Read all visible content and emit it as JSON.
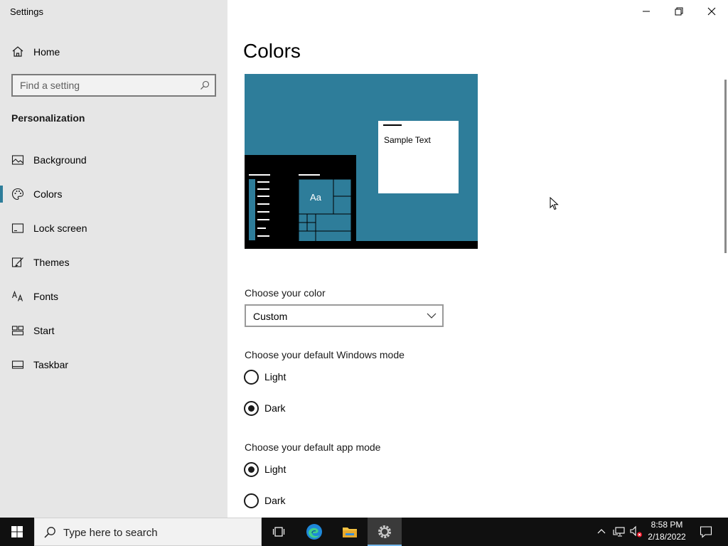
{
  "window": {
    "title": "Settings",
    "controls": [
      "minimize",
      "restore",
      "close"
    ]
  },
  "sidebar": {
    "home_label": "Home",
    "search_placeholder": "Find a setting",
    "section_title": "Personalization",
    "items": [
      {
        "label": "Background",
        "icon": "picture-icon",
        "active": false
      },
      {
        "label": "Colors",
        "icon": "palette-icon",
        "active": true
      },
      {
        "label": "Lock screen",
        "icon": "lock-screen-icon",
        "active": false
      },
      {
        "label": "Themes",
        "icon": "paintbrush-icon",
        "active": false
      },
      {
        "label": "Fonts",
        "icon": "fonts-icon",
        "active": false
      },
      {
        "label": "Start",
        "icon": "start-tiles-icon",
        "active": false
      },
      {
        "label": "Taskbar",
        "icon": "taskbar-icon",
        "active": false
      }
    ]
  },
  "main": {
    "title": "Colors",
    "preview": {
      "sample_text": "Sample Text",
      "tile_text": "Aa",
      "accent_color": "#2e7d9a"
    },
    "choose_color": {
      "label": "Choose your color",
      "selected": "Custom"
    },
    "windows_mode": {
      "label": "Choose your default Windows mode",
      "options": [
        "Light",
        "Dark"
      ],
      "selected": "Dark"
    },
    "app_mode": {
      "label": "Choose your default app mode",
      "options": [
        "Light",
        "Dark"
      ],
      "selected": "Light"
    }
  },
  "taskbar": {
    "search_placeholder": "Type here to search",
    "apps": [
      "task-view-icon",
      "edge-icon",
      "file-explorer-icon",
      "settings-icon"
    ],
    "active_app": "settings-icon",
    "tray": [
      "chevron-up-icon",
      "network-icon",
      "volume-muted-icon"
    ],
    "time": "8:58 PM",
    "date": "2/18/2022",
    "notification_icon": "notification-icon"
  }
}
